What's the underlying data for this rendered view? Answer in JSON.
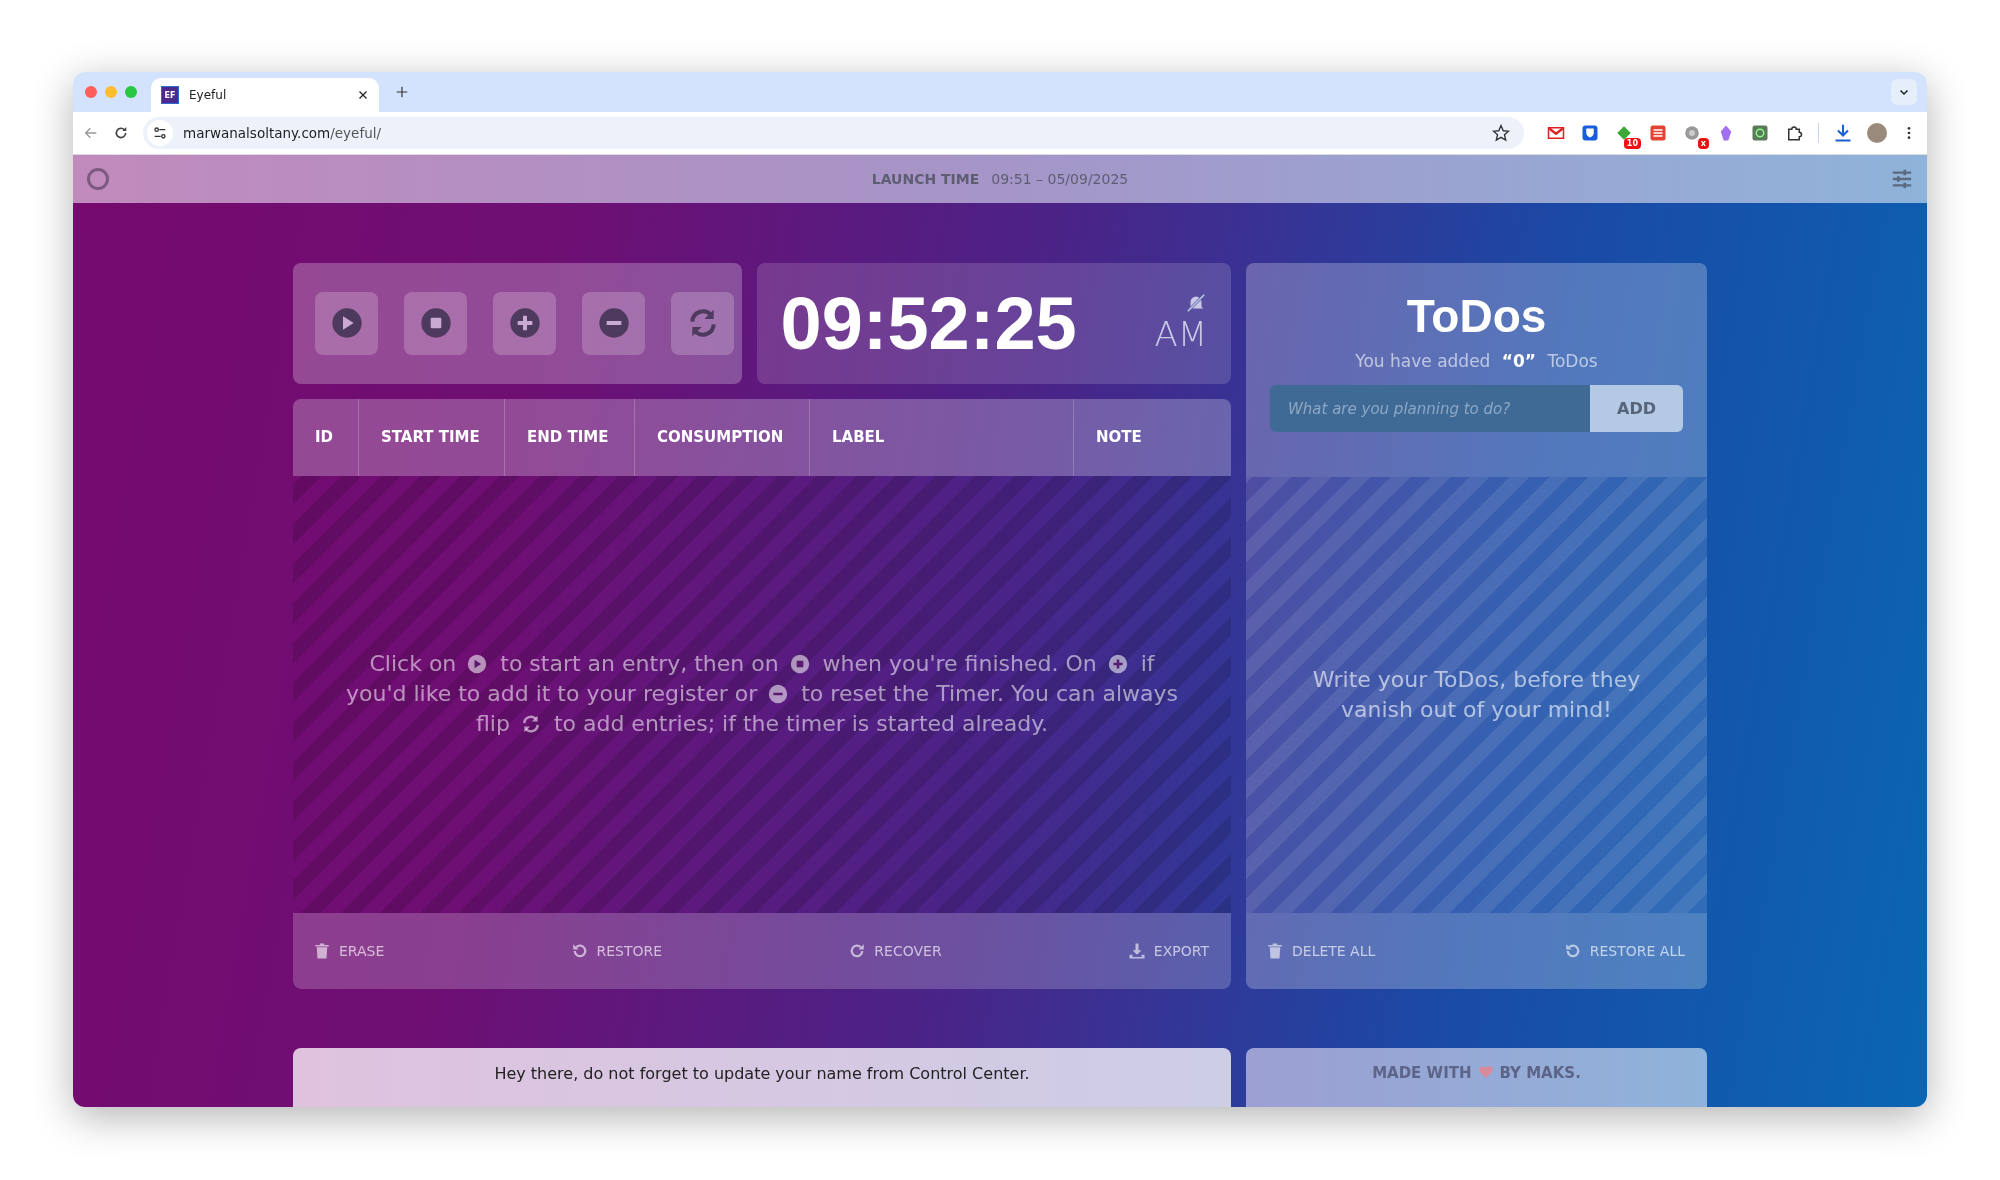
{
  "browser": {
    "tab": {
      "favicon_text": "EF",
      "title": "Eyeful",
      "selected": true
    },
    "url_host": "marwanalsoltany.com",
    "url_path": "/eyeful/",
    "extensions": [
      {
        "kind": "mail"
      },
      {
        "kind": "shield"
      },
      {
        "kind": "tag",
        "badge": "10"
      },
      {
        "kind": "list"
      },
      {
        "kind": "record",
        "badge": "x"
      },
      {
        "kind": "crystal"
      },
      {
        "kind": "photo"
      },
      {
        "kind": "puzzle"
      }
    ]
  },
  "app_header": {
    "label": "LAUNCH TIME",
    "value": "09:51 – 05/09/2025"
  },
  "controls": [
    {
      "kind": "play"
    },
    {
      "kind": "stop"
    },
    {
      "kind": "add"
    },
    {
      "kind": "remove"
    },
    {
      "kind": "refresh"
    }
  ],
  "clock": {
    "time": "09:52:25",
    "meridiem": "AM",
    "alarm_muted": true
  },
  "table": {
    "columns": [
      "ID",
      "START TIME",
      "END TIME",
      "CONSUMPTION",
      "LABEL",
      "NOTE"
    ],
    "empty_message": [
      {
        "kind": "text",
        "text": "Click on"
      },
      {
        "kind": "play"
      },
      {
        "kind": "text",
        "text": "to start an entry, then on"
      },
      {
        "kind": "stop"
      },
      {
        "kind": "text",
        "text": "when you're finished. On"
      },
      {
        "kind": "add"
      },
      {
        "kind": "text",
        "text": "if you'd like to add it to your register or"
      },
      {
        "kind": "remove"
      },
      {
        "kind": "text",
        "text": "to reset the Timer. You can always flip"
      },
      {
        "kind": "refresh"
      },
      {
        "kind": "text",
        "text": "to add entries; if the timer is started already."
      }
    ],
    "actions": [
      {
        "kind": "trash",
        "label": "ERASE"
      },
      {
        "kind": "undo",
        "label": "RESTORE"
      },
      {
        "kind": "redo",
        "label": "RECOVER"
      },
      {
        "kind": "download",
        "label": "EXPORT"
      }
    ]
  },
  "todos": {
    "title": "ToDos",
    "count_text": "You have added **“0”** ToDos",
    "placeholder": "What are you planning to do?",
    "add_button": "ADD",
    "empty_message": "Write your ToDos, before they vanish out of your mind!",
    "actions": [
      {
        "kind": "trash",
        "label": "DELETE ALL"
      },
      {
        "kind": "undo",
        "label": "RESTORE ALL"
      }
    ]
  },
  "banner": "Hey there, do not forget to update your name from Control Center.",
  "credit": {
    "before": "MADE WITH",
    "after": "BY MAKS."
  }
}
